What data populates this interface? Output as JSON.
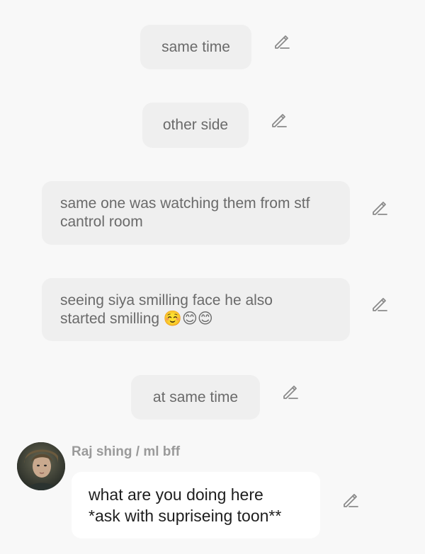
{
  "messages": [
    {
      "text": "same time"
    },
    {
      "text": "other side"
    },
    {
      "lines": [
        "same one was watching them from stf",
        "cantrol room"
      ]
    },
    {
      "lines": [
        "seeing siya smilling face he also",
        "started smilling ☺️😊😊"
      ]
    },
    {
      "text": "at same time"
    }
  ],
  "reply": {
    "sender": "Raj shing / ml bff",
    "lines": [
      "what are you doing here",
      "*ask with supriseing toon**"
    ]
  },
  "icons": {
    "edit": "pencil-edit-icon",
    "avatar": "character-portrait"
  },
  "colors": {
    "background": "#f8f8f8",
    "user_bubble": "#efefef",
    "reply_bubble": "#ffffff",
    "bubble_text": "#6a6a6a",
    "reply_text": "#1e1e1e",
    "sender_name": "#9a9a9a",
    "icon": "#8a8a8a"
  }
}
